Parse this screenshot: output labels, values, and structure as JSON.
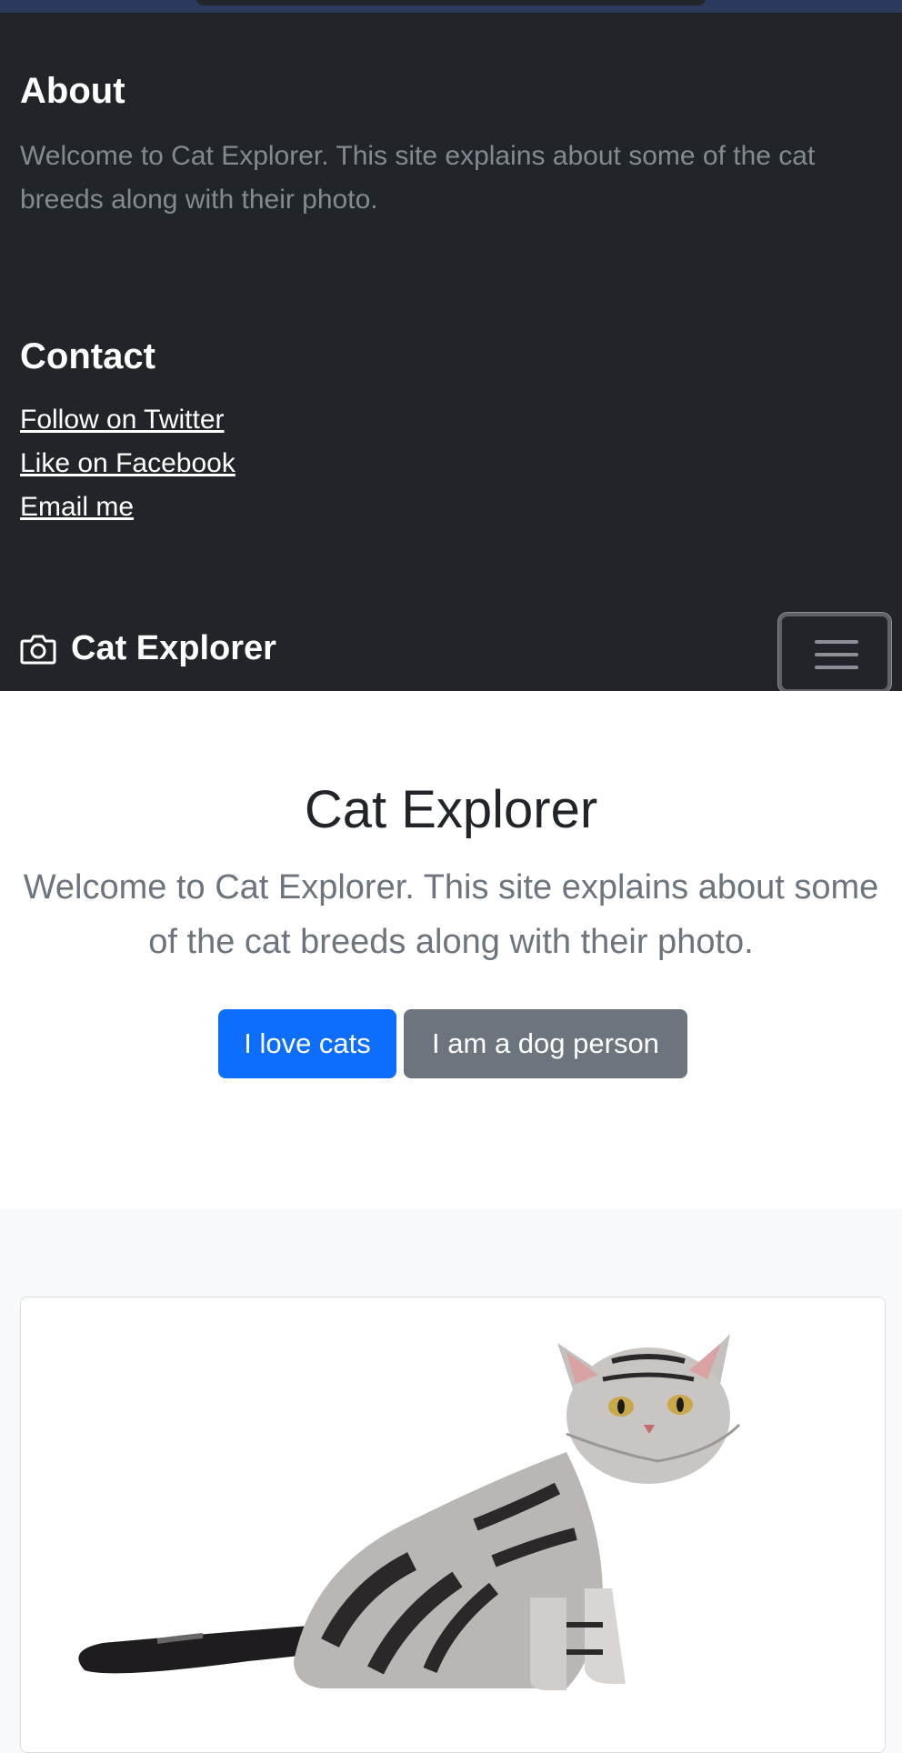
{
  "about": {
    "title": "About",
    "text": "Welcome to Cat Explorer. This site explains about some of the cat breeds along with their photo."
  },
  "contact": {
    "title": "Contact",
    "links": [
      "Follow on Twitter",
      "Like on Facebook",
      "Email me"
    ]
  },
  "navbar": {
    "brand": "Cat Explorer",
    "brand_icon": "camera-icon",
    "toggler_icon": "hamburger-icon"
  },
  "hero": {
    "title": "Cat Explorer",
    "lead": "Welcome to Cat Explorer. This site explains about some of the cat breeds along with their photo.",
    "primary_button": "I love cats",
    "secondary_button": "I am a dog person"
  },
  "card": {
    "image": "cat-photo"
  },
  "colors": {
    "dark_bg": "#212529",
    "primary": "#0d6efd",
    "secondary": "#6c757d"
  }
}
